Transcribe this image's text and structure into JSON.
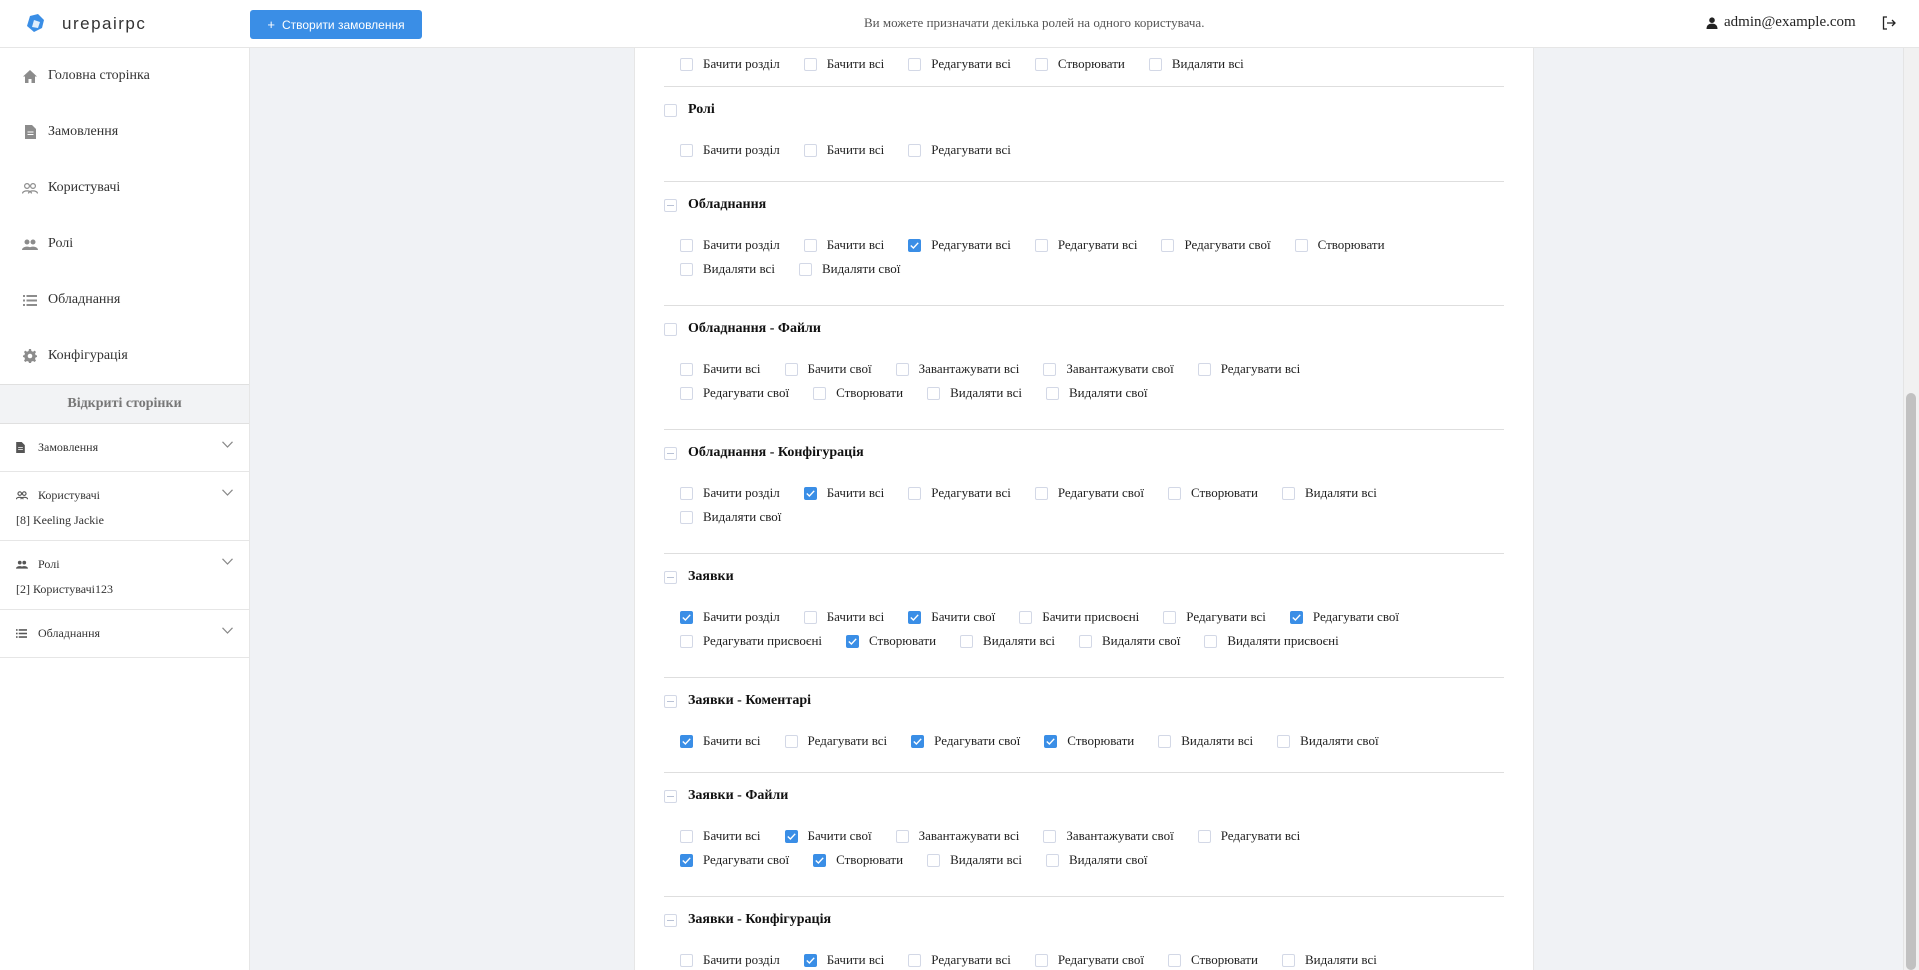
{
  "header": {
    "logo_text": "urepairpc",
    "create_button_label": "Створити замовлення",
    "message": "Ви можете призначати декілька ролей на одного користувача.",
    "user_email": "admin@example.com"
  },
  "sidebar": {
    "nav": [
      {
        "label": "Головна сторінка",
        "icon": "home-icon"
      },
      {
        "label": "Замовлення",
        "icon": "document-icon"
      },
      {
        "label": "Користувачі",
        "icon": "users-icon"
      },
      {
        "label": "Ролі",
        "icon": "roles-icon"
      },
      {
        "label": "Обладнання",
        "icon": "list-icon"
      },
      {
        "label": "Конфігурація",
        "icon": "gear-icon"
      }
    ],
    "open_pages_title": "Відкриті сторінки",
    "open_groups": [
      {
        "label": "Замовлення",
        "icon": "document-icon",
        "sub": ""
      },
      {
        "label": "Користувачі",
        "icon": "users-icon",
        "sub": "[8] Keeling Jackie"
      },
      {
        "label": "Ролі",
        "icon": "roles-icon",
        "sub": "[2] Користувачі123"
      },
      {
        "label": "Обладнання",
        "icon": "list-icon",
        "sub": ""
      }
    ]
  },
  "permissions": {
    "sections": [
      {
        "title": "",
        "title_state": "none",
        "perms": [
          {
            "label": "Бачити розділ",
            "checked": false
          },
          {
            "label": "Бачити всі",
            "checked": false
          },
          {
            "label": "Редагувати всі",
            "checked": false
          },
          {
            "label": "Створювати",
            "checked": false
          },
          {
            "label": "Видаляти всі",
            "checked": false
          }
        ]
      },
      {
        "title": "Ролі",
        "title_state": "empty",
        "perms": [
          {
            "label": "Бачити розділ",
            "checked": false
          },
          {
            "label": "Бачити всі",
            "checked": false
          },
          {
            "label": "Редагувати всі",
            "checked": false
          }
        ]
      },
      {
        "title": "Обладнання",
        "title_state": "indeterminate",
        "perms": [
          {
            "label": "Бачити розділ",
            "checked": false
          },
          {
            "label": "Бачити всі",
            "checked": false
          },
          {
            "label": "Редагувати всі",
            "checked": true
          },
          {
            "label": "Редагувати всі",
            "checked": false
          },
          {
            "label": "Редагувати свої",
            "checked": false
          },
          {
            "label": "Створювати",
            "checked": false
          },
          {
            "label": "Видаляти всі",
            "checked": false
          },
          {
            "label": "Видаляти свої",
            "checked": false
          }
        ]
      },
      {
        "title": "Обладнання - Файли",
        "title_state": "empty",
        "perms": [
          {
            "label": "Бачити всі",
            "checked": false
          },
          {
            "label": "Бачити свої",
            "checked": false
          },
          {
            "label": "Завантажувати всі",
            "checked": false
          },
          {
            "label": "Завантажувати свої",
            "checked": false
          },
          {
            "label": "Редагувати всі",
            "checked": false
          },
          {
            "label": "Редагувати свої",
            "checked": false
          },
          {
            "label": "Створювати",
            "checked": false
          },
          {
            "label": "Видаляти всі",
            "checked": false
          },
          {
            "label": "Видаляти свої",
            "checked": false
          }
        ]
      },
      {
        "title": "Обладнання - Конфігурація",
        "title_state": "indeterminate",
        "perms": [
          {
            "label": "Бачити розділ",
            "checked": false
          },
          {
            "label": "Бачити всі",
            "checked": true
          },
          {
            "label": "Редагувати всі",
            "checked": false
          },
          {
            "label": "Редагувати свої",
            "checked": false
          },
          {
            "label": "Створювати",
            "checked": false
          },
          {
            "label": "Видаляти всі",
            "checked": false
          },
          {
            "label": "Видаляти свої",
            "checked": false
          }
        ]
      },
      {
        "title": "Заявки",
        "title_state": "indeterminate",
        "perms": [
          {
            "label": "Бачити розділ",
            "checked": true
          },
          {
            "label": "Бачити всі",
            "checked": false
          },
          {
            "label": "Бачити свої",
            "checked": true
          },
          {
            "label": "Бачити присвоєні",
            "checked": false
          },
          {
            "label": "Редагувати всі",
            "checked": false
          },
          {
            "label": "Редагувати свої",
            "checked": true
          },
          {
            "label": "Редагувати присвоєні",
            "checked": false
          },
          {
            "label": "Створювати",
            "checked": true
          },
          {
            "label": "Видаляти всі",
            "checked": false
          },
          {
            "label": "Видаляти свої",
            "checked": false
          },
          {
            "label": "Видаляти присвоєні",
            "checked": false
          }
        ]
      },
      {
        "title": "Заявки - Коментарі",
        "title_state": "indeterminate",
        "perms": [
          {
            "label": "Бачити всі",
            "checked": true
          },
          {
            "label": "Редагувати всі",
            "checked": false
          },
          {
            "label": "Редагувати свої",
            "checked": true
          },
          {
            "label": "Створювати",
            "checked": true
          },
          {
            "label": "Видаляти всі",
            "checked": false
          },
          {
            "label": "Видаляти свої",
            "checked": false
          }
        ]
      },
      {
        "title": "Заявки - Файли",
        "title_state": "indeterminate",
        "perms": [
          {
            "label": "Бачити всі",
            "checked": false
          },
          {
            "label": "Бачити свої",
            "checked": true
          },
          {
            "label": "Завантажувати всі",
            "checked": false
          },
          {
            "label": "Завантажувати свої",
            "checked": false
          },
          {
            "label": "Редагувати всі",
            "checked": false
          },
          {
            "label": "Редагувати свої",
            "checked": true
          },
          {
            "label": "Створювати",
            "checked": true
          },
          {
            "label": "Видаляти всі",
            "checked": false
          },
          {
            "label": "Видаляти свої",
            "checked": false
          }
        ]
      },
      {
        "title": "Заявки - Конфігурація",
        "title_state": "indeterminate",
        "perms": [
          {
            "label": "Бачити розділ",
            "checked": false
          },
          {
            "label": "Бачити всі",
            "checked": true
          },
          {
            "label": "Редагувати всі",
            "checked": false
          },
          {
            "label": "Редагувати свої",
            "checked": false
          },
          {
            "label": "Створювати",
            "checked": false
          },
          {
            "label": "Видаляти всі",
            "checked": false
          }
        ]
      }
    ]
  },
  "colors": {
    "accent": "#3a8ee6",
    "background": "#f0f2f5"
  }
}
